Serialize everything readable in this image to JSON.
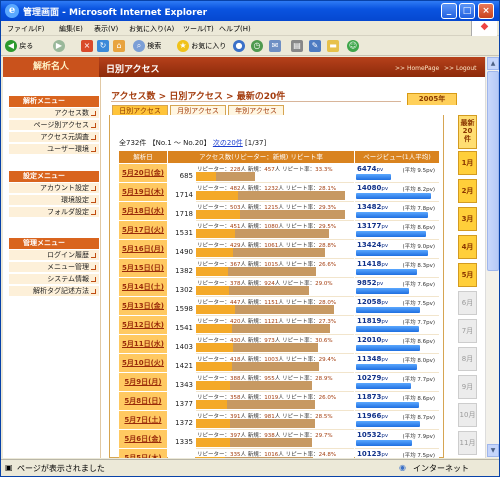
{
  "window": {
    "title": "管理画面 - Microsoft Internet Explorer",
    "minimize": "_",
    "maximize": "□",
    "close": "×"
  },
  "menu": [
    "ファイル(F)",
    "編集(E)",
    "表示(V)",
    "お気に入り(A)",
    "ツール(T)",
    "ヘルプ(H)"
  ],
  "toolbar": {
    "back": "戻る",
    "search": "検索",
    "favorites": "お気に入り"
  },
  "status": {
    "text": "ページが表示されました",
    "zone": "インターネット"
  },
  "site": {
    "name": "解析名人",
    "section": "日別アクセス",
    "home_link": ">> HomePage",
    "logout_link": ">> Logout"
  },
  "nav": [
    {
      "heading": "解析メニュー",
      "items": [
        "アクセス数",
        "ページ別アクセス",
        "アクセス元調査",
        "ユーザー環境"
      ]
    },
    {
      "heading": "設定メニュー",
      "items": [
        "アカウント設定",
        "環境設定",
        "フォルダ設定"
      ]
    },
    {
      "heading": "管理メニュー",
      "items": [
        "ログイン履歴",
        "メニュー管理",
        "システム情報",
        "解析タグ記述方法"
      ]
    }
  ],
  "breadcrumb": "アクセス数 > 日別アクセス > 最新の20件",
  "year_tab": "2005年",
  "month_tabs": [
    {
      "label": "最新\n20\n件",
      "state": "selected"
    },
    {
      "label": "1月",
      "state": "on"
    },
    {
      "label": "2月",
      "state": "on"
    },
    {
      "label": "3月",
      "state": "on"
    },
    {
      "label": "4月",
      "state": "on"
    },
    {
      "label": "5月",
      "state": "on"
    },
    {
      "label": "6月",
      "state": "off"
    },
    {
      "label": "7月",
      "state": "off"
    },
    {
      "label": "8月",
      "state": "off"
    },
    {
      "label": "9月",
      "state": "off"
    },
    {
      "label": "10月",
      "state": "off"
    },
    {
      "label": "11月",
      "state": "off"
    }
  ],
  "page_tabs": [
    "日別アクセス",
    "月別アクセス",
    "年別アクセス"
  ],
  "summary": {
    "prefix": "全732件 【No.1 ～ No.20】",
    "next": "次の20件",
    "pages": "[1/37]"
  },
  "headers": {
    "date": "解析日",
    "access": "アクセス数(リピーター：新規) リピート率",
    "pv": "ページビュー(1人平均)"
  },
  "rows": [
    {
      "date": "5月20日(金)",
      "total": 685,
      "repeat": 228,
      "new": 457,
      "rate": "33.3%",
      "pv": "6474",
      "avg": "(平均 9.5pv)"
    },
    {
      "date": "5月19日(木)",
      "total": 1714,
      "repeat": 482,
      "new": 1232,
      "rate": "28.1%",
      "pv": "14080",
      "avg": "(平均 8.2pv)"
    },
    {
      "date": "5月18日(水)",
      "total": 1718,
      "repeat": 503,
      "new": 1215,
      "rate": "29.3%",
      "pv": "13482",
      "avg": "(平均 7.8pv)"
    },
    {
      "date": "5月17日(火)",
      "total": 1531,
      "repeat": 451,
      "new": 1080,
      "rate": "29.5%",
      "pv": "13177",
      "avg": "(平均 8.6pv)"
    },
    {
      "date": "5月16日(月)",
      "total": 1490,
      "repeat": 429,
      "new": 1061,
      "rate": "28.8%",
      "pv": "13424",
      "avg": "(平均 9.0pv)"
    },
    {
      "date": "5月15日(日)",
      "total": 1382,
      "repeat": 367,
      "new": 1015,
      "rate": "26.6%",
      "pv": "11418",
      "avg": "(平均 8.3pv)"
    },
    {
      "date": "5月14日(土)",
      "total": 1302,
      "repeat": 378,
      "new": 924,
      "rate": "29.0%",
      "pv": "9852",
      "avg": "(平均 7.6pv)"
    },
    {
      "date": "5月13日(金)",
      "total": 1598,
      "repeat": 447,
      "new": 1151,
      "rate": "28.0%",
      "pv": "12058",
      "avg": "(平均 7.5pv)"
    },
    {
      "date": "5月12日(木)",
      "total": 1541,
      "repeat": 420,
      "new": 1121,
      "rate": "27.3%",
      "pv": "11819",
      "avg": "(平均 7.7pv)"
    },
    {
      "date": "5月11日(水)",
      "total": 1403,
      "repeat": 430,
      "new": 973,
      "rate": "30.6%",
      "pv": "12010",
      "avg": "(平均 8.6pv)"
    },
    {
      "date": "5月10日(火)",
      "total": 1421,
      "repeat": 418,
      "new": 1003,
      "rate": "29.4%",
      "pv": "11348",
      "avg": "(平均 8.0pv)"
    },
    {
      "date": "5月9日(月)",
      "total": 1343,
      "repeat": 388,
      "new": 955,
      "rate": "28.9%",
      "pv": "10279",
      "avg": "(平均 7.7pv)"
    },
    {
      "date": "5月8日(日)",
      "total": 1377,
      "repeat": 358,
      "new": 1019,
      "rate": "26.0%",
      "pv": "11873",
      "avg": "(平均 8.6pv)"
    },
    {
      "date": "5月7日(土)",
      "total": 1372,
      "repeat": 391,
      "new": 981,
      "rate": "28.5%",
      "pv": "11966",
      "avg": "(平均 8.7pv)"
    },
    {
      "date": "5月6日(金)",
      "total": 1335,
      "repeat": 397,
      "new": 938,
      "rate": "29.7%",
      "pv": "10532",
      "avg": "(平均 7.9pv)"
    },
    {
      "date": "5月5日(木)",
      "total": 1351,
      "repeat": 335,
      "new": 1016,
      "rate": "24.8%",
      "pv": "10123",
      "avg": "(平均 7.5pv)"
    }
  ],
  "labels": {
    "repeater": "リピーター：",
    "new": "新規：",
    "rate": "リピート率：",
    "person": "人",
    "pv_unit": "pv"
  }
}
